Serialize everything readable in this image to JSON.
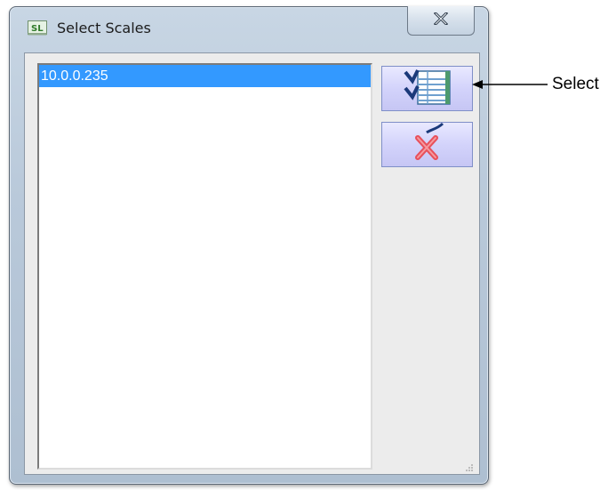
{
  "window": {
    "title": "Select Scales",
    "app_icon": "sl-app-icon",
    "close_icon": "close-icon"
  },
  "scales_list": {
    "items": [
      {
        "label": "10.0.0.235",
        "selected": true
      }
    ]
  },
  "toolbar": {
    "select_icon": "checklist-icon",
    "cancel_icon": "red-x-icon"
  },
  "callout": {
    "label": "Select"
  },
  "colors": {
    "selection": "#3399ff",
    "button_face": "#d3d3fb",
    "cancel_x": "#e8505b"
  }
}
